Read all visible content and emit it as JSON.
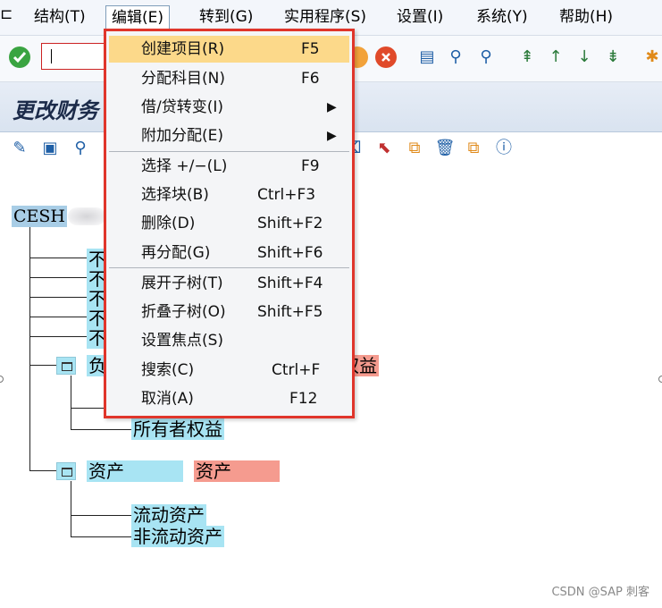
{
  "menubar": {
    "glyph": "⊏",
    "items": [
      {
        "label": "结构(T)"
      },
      {
        "label": "编辑(E)"
      },
      {
        "label": "转到(G)"
      },
      {
        "label": "实用程序(S)"
      },
      {
        "label": "设置(I)"
      },
      {
        "label": "系统(Y)"
      },
      {
        "label": "帮助(H)"
      }
    ]
  },
  "page": {
    "title": "更改财务"
  },
  "dropdown": {
    "items": [
      {
        "label": "创建项目(R)",
        "shortcut": "F5"
      },
      {
        "label": "分配科目(N)",
        "shortcut": "F6"
      },
      {
        "label": "借/贷转变(I)",
        "submenu": "▶"
      },
      {
        "label": "附加分配(E)",
        "submenu": "▶"
      },
      {
        "label": "选择 +/−(L)",
        "shortcut": "F9"
      },
      {
        "label": "选择块(B)",
        "shortcut": "Ctrl+F3"
      },
      {
        "label": "删除(D)",
        "shortcut": "Shift+F2"
      },
      {
        "label": "再分配(G)",
        "shortcut": "Shift+F6"
      },
      {
        "label": "展开子树(T)",
        "shortcut": "Shift+F4"
      },
      {
        "label": "折叠子树(O)",
        "shortcut": "Shift+F5"
      },
      {
        "label": "设置焦点(S)"
      },
      {
        "label": "搜索(C)",
        "shortcut": "Ctrl+F"
      },
      {
        "label": "取消(A)",
        "shortcut": "F12"
      }
    ]
  },
  "tree": {
    "root": "CESH",
    "partial_rows": [
      "不",
      "不",
      "不",
      "不",
      "不"
    ],
    "liabilities_node": {
      "label_partial": "负",
      "pink_partial": "权益"
    },
    "equity_leaf": "所有者权益",
    "assets_node": {
      "label": "资产",
      "pink": "资产"
    },
    "asset_children": [
      "流动资产",
      "非流动资产"
    ]
  },
  "watermark": "CSDN @SAP 刺客",
  "colors": {
    "highlight": "#fcd98a",
    "menu_border": "#e0352b",
    "node_blue": "#a8e4f3",
    "node_pink": "#f59b8f"
  }
}
